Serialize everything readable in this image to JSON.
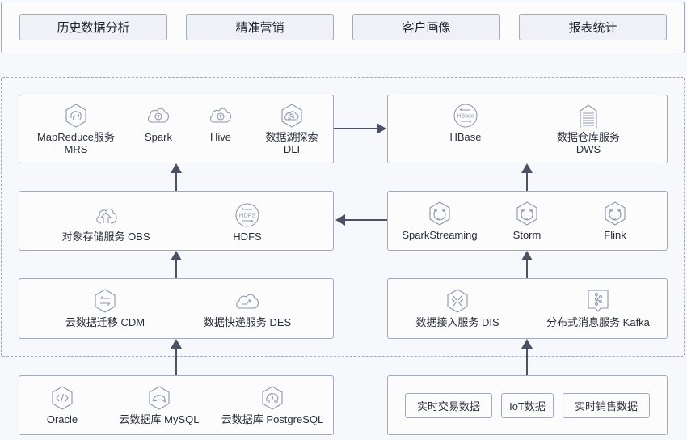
{
  "applications": [
    {
      "label": "历史数据分析"
    },
    {
      "label": "精准营销"
    },
    {
      "label": "客户画像"
    },
    {
      "label": "报表统计"
    }
  ],
  "batch": {
    "compute": [
      {
        "label": "MapReduce服务",
        "sublabel": "MRS",
        "icon": "elephant-hexagon-icon"
      },
      {
        "label": "Spark",
        "sublabel": "",
        "icon": "cloud-upload-icon"
      },
      {
        "label": "Hive",
        "sublabel": "",
        "icon": "cloud-upload-icon"
      },
      {
        "label": "数据湖探索",
        "sublabel": "DLI",
        "icon": "cloud-search-hexagon-icon"
      }
    ],
    "storage": [
      {
        "label": "对象存储服务 OBS",
        "icon": "cloud-upload-icon"
      },
      {
        "label": "HDFS",
        "icon": "hdfs-circle-icon",
        "icon_text": "HDFS"
      }
    ],
    "ingest": [
      {
        "label": "云数据迁移 CDM",
        "icon": "swap-arrows-hexagon-icon"
      },
      {
        "label": "数据快递服务 DES",
        "icon": "cloud-transfer-icon"
      }
    ],
    "sources": [
      {
        "label": "Oracle",
        "icon": "code-hexagon-icon"
      },
      {
        "label": "云数据库 MySQL",
        "icon": "dolphin-hexagon-icon"
      },
      {
        "label": "云数据库 PostgreSQL",
        "icon": "elephant-hexagon-icon"
      }
    ]
  },
  "realtime": {
    "serving": [
      {
        "label": "HBase",
        "sublabel": "",
        "icon": "hbase-circle-icon",
        "icon_text": "HBase"
      },
      {
        "label": "数据仓库服务",
        "sublabel": "DWS",
        "icon": "warehouse-icon"
      }
    ],
    "stream": [
      {
        "label": "SparkStreaming",
        "icon": "stream-hexagon-icon"
      },
      {
        "label": "Storm",
        "icon": "stream-hexagon-icon"
      },
      {
        "label": "Flink",
        "icon": "stream-hexagon-icon"
      }
    ],
    "ingest": [
      {
        "label": "数据接入服务 DIS",
        "icon": "cross-arrows-hexagon-icon"
      },
      {
        "label": "分布式消息服务 Kafka",
        "icon": "message-nodes-icon"
      }
    ],
    "sources": [
      {
        "label": "实时交易数据"
      },
      {
        "label": "IoT数据"
      },
      {
        "label": "实时销售数据"
      }
    ]
  },
  "colors": {
    "border": "#a4aabd",
    "arrow": "#4c5165",
    "icon": "#8f96ad",
    "button_bg": "#eff1f6"
  }
}
